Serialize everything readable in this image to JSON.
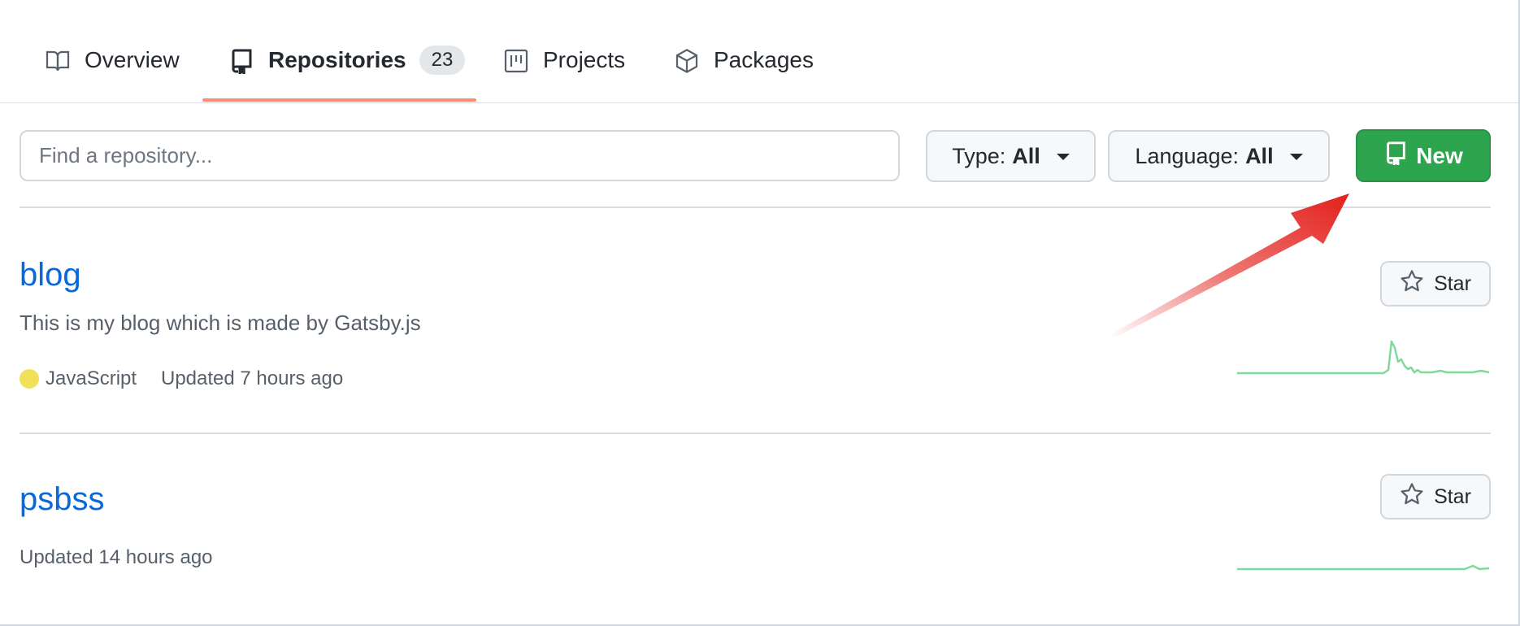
{
  "tabs": [
    {
      "label": "Overview",
      "icon": "book-icon"
    },
    {
      "label": "Repositories",
      "icon": "repo-icon",
      "count": "23",
      "selected": true
    },
    {
      "label": "Projects",
      "icon": "project-icon"
    },
    {
      "label": "Packages",
      "icon": "package-icon"
    }
  ],
  "filters": {
    "search_placeholder": "Find a repository...",
    "type_label": "Type:",
    "type_value": "All",
    "language_label": "Language:",
    "language_value": "All",
    "new_label": "New"
  },
  "repos": [
    {
      "name": "blog",
      "description": "This is my blog which is made by Gatsby.js",
      "language": "JavaScript",
      "language_color": "#f1e05a",
      "updated": "Updated 7 hours ago",
      "star_label": "Star"
    },
    {
      "name": "psbss",
      "updated": "Updated 14 hours ago",
      "star_label": "Star"
    }
  ],
  "colors": {
    "accent_link": "#0969da",
    "new_button": "#2da44e",
    "tab_underline": "#fd8c73",
    "sparkline": "#7fd99a",
    "annotation_arrow": "#e3201b"
  }
}
